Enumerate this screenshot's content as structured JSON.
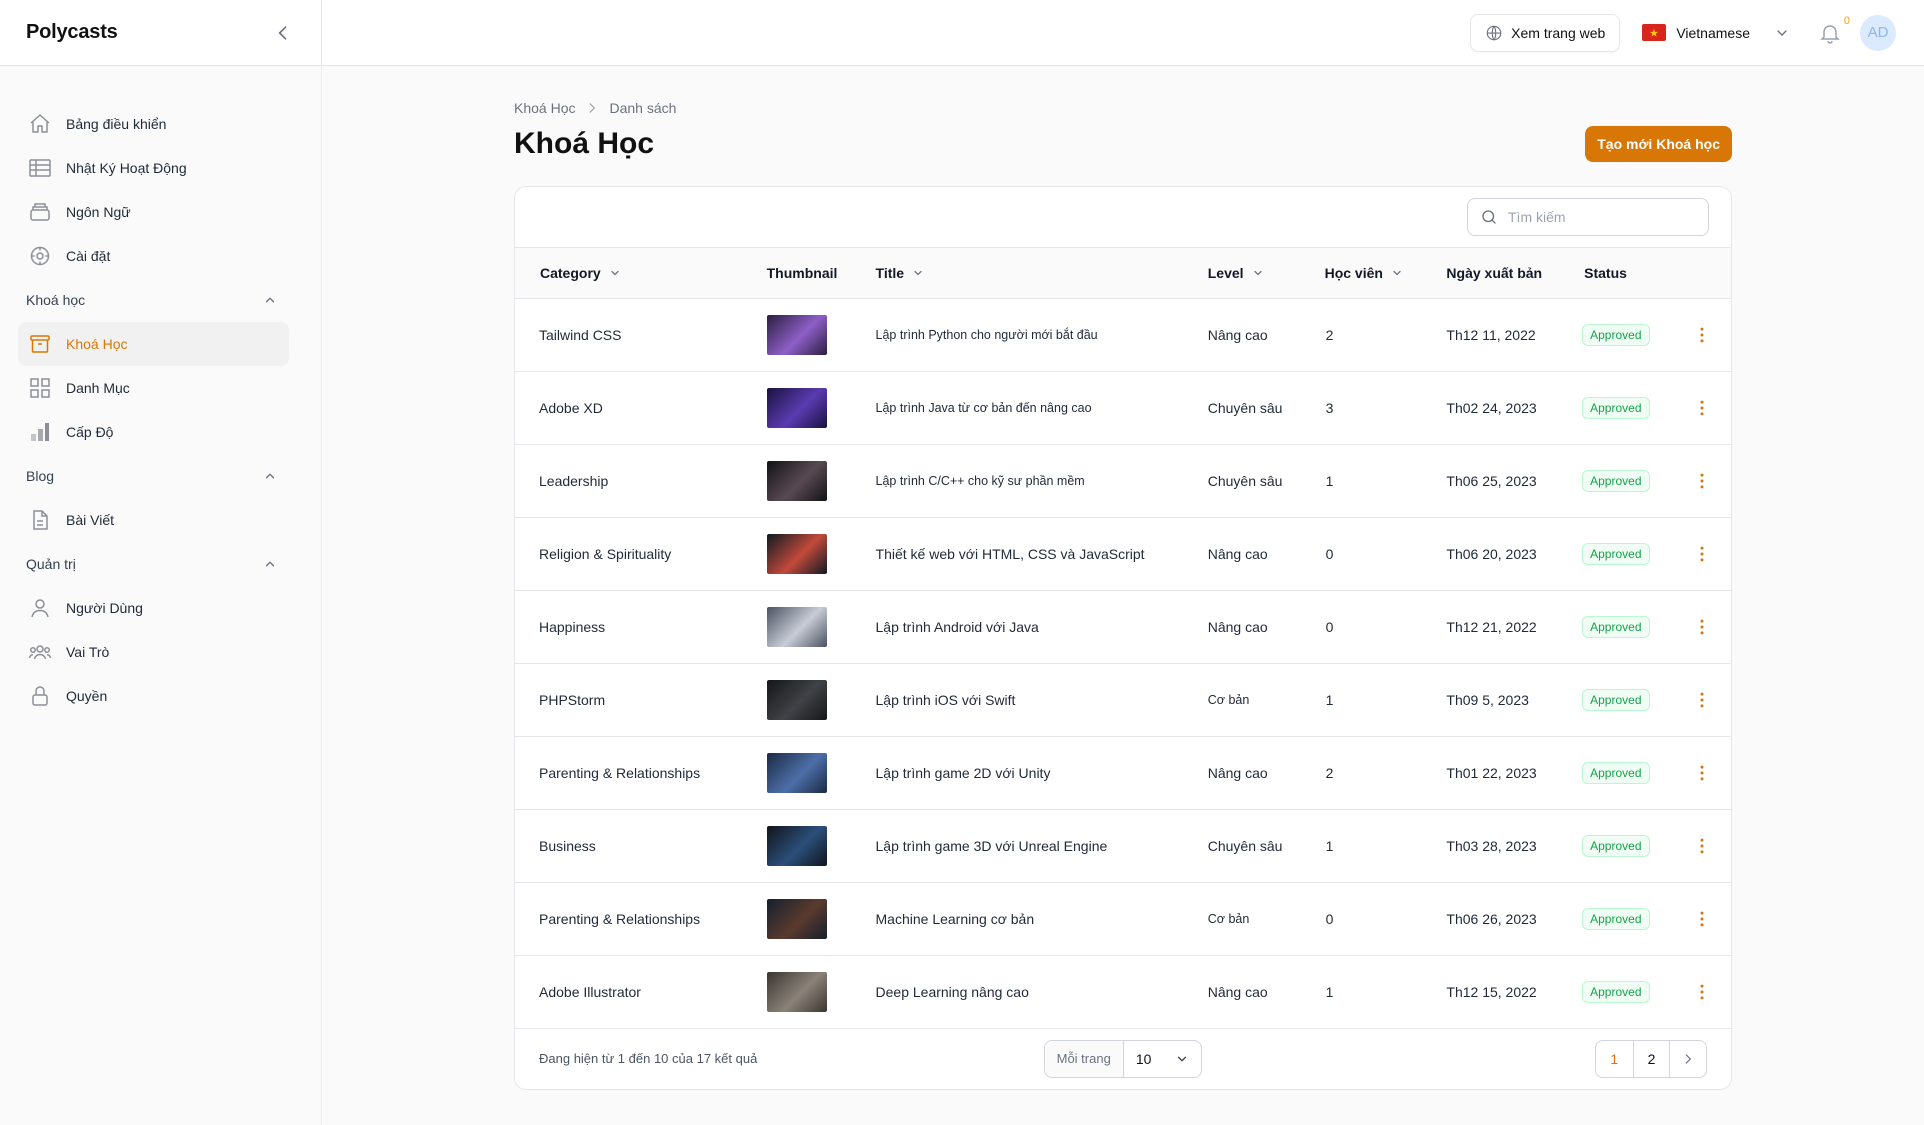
{
  "app": {
    "brand": "Polycasts"
  },
  "topbar": {
    "view_site": "Xem trang web",
    "language": "Vietnamese",
    "notification_count": "0",
    "avatar_initials": "AD"
  },
  "sidebar": {
    "top_items": [
      {
        "label": "Bảng điều khiển",
        "icon": "home-icon"
      },
      {
        "label": "Nhật Ký Hoạt Động",
        "icon": "table-icon"
      },
      {
        "label": "Ngôn Ngữ",
        "icon": "archive-icon"
      },
      {
        "label": "Cài đặt",
        "icon": "gear-icon"
      }
    ],
    "groups": [
      {
        "title": "Khoá học",
        "items": [
          {
            "label": "Khoá Học",
            "icon": "archive-box-icon",
            "active": true
          },
          {
            "label": "Danh Mục",
            "icon": "grid-icon"
          },
          {
            "label": "Cấp Độ",
            "icon": "bar-chart-icon"
          }
        ]
      },
      {
        "title": "Blog",
        "items": [
          {
            "label": "Bài Viết",
            "icon": "document-icon"
          }
        ]
      },
      {
        "title": "Quản trị",
        "items": [
          {
            "label": "Người Dùng",
            "icon": "user-icon"
          },
          {
            "label": "Vai Trò",
            "icon": "users-icon"
          },
          {
            "label": "Quyền",
            "icon": "lock-icon"
          }
        ]
      }
    ]
  },
  "breadcrumb": {
    "parent": "Khoá Học",
    "current": "Danh sách"
  },
  "page": {
    "title": "Khoá Học",
    "create_button": "Tạo mới Khoá học"
  },
  "search": {
    "placeholder": "Tìm kiếm"
  },
  "table": {
    "columns": {
      "category": "Category",
      "thumbnail": "Thumbnail",
      "title": "Title",
      "level": "Level",
      "students": "Học viên",
      "published": "Ngày xuất bản",
      "status": "Status"
    },
    "rows": [
      {
        "category": "Tailwind CSS",
        "title": "Lập trình Python cho người mới bắt đầu",
        "level": "Nâng cao",
        "students": "2",
        "published": "Th12 11, 2022",
        "status": "Approved",
        "thumb": [
          "#2a1e3e",
          "#8e5fc8"
        ]
      },
      {
        "category": "Adobe XD",
        "title": "Lập trình Java từ cơ bản đến nâng cao",
        "level": "Chuyên sâu",
        "students": "3",
        "published": "Th02 24, 2023",
        "status": "Approved",
        "thumb": [
          "#1a1240",
          "#5a3bb0"
        ]
      },
      {
        "category": "Leadership",
        "title": "Lập trình C/C++ cho kỹ sư phần mềm",
        "level": "Chuyên sâu",
        "students": "1",
        "published": "Th06 25, 2023",
        "status": "Approved",
        "thumb": [
          "#111216",
          "#5a4a52"
        ]
      },
      {
        "category": "Religion & Spirituality",
        "title": "Thiết kế web với HTML, CSS và JavaScript",
        "level": "Nâng cao",
        "students": "0",
        "published": "Th06 20, 2023",
        "status": "Approved",
        "thumb": [
          "#0e1a22",
          "#c2493a"
        ]
      },
      {
        "category": "Happiness",
        "title": "Lập trình Android với Java",
        "level": "Nâng cao",
        "students": "0",
        "published": "Th12 21, 2022",
        "status": "Approved",
        "thumb": [
          "#4a5260",
          "#c8ccd6"
        ]
      },
      {
        "category": "PHPStorm",
        "title": "Lập trình iOS với Swift",
        "level": "Cơ bản",
        "students": "1",
        "published": "Th09 5, 2023",
        "status": "Approved",
        "thumb": [
          "#151618",
          "#3f4246"
        ]
      },
      {
        "category": "Parenting & Relationships",
        "title": "Lập trình game 2D với Unity",
        "level": "Nâng cao",
        "students": "2",
        "published": "Th01 22, 2023",
        "status": "Approved",
        "thumb": [
          "#1b2a44",
          "#4c6ea8"
        ]
      },
      {
        "category": "Business",
        "title": "Lập trình game 3D với Unreal Engine",
        "level": "Chuyên sâu",
        "students": "1",
        "published": "Th03 28, 2023",
        "status": "Approved",
        "thumb": [
          "#12141c",
          "#2b4f7a"
        ]
      },
      {
        "category": "Parenting & Relationships",
        "title": "Machine Learning cơ bản",
        "level": "Cơ bản",
        "students": "0",
        "published": "Th06 26, 2023",
        "status": "Approved",
        "thumb": [
          "#14202e",
          "#5b3a2e"
        ]
      },
      {
        "category": "Adobe Illustrator",
        "title": "Deep Learning nâng cao",
        "level": "Nâng cao",
        "students": "1",
        "published": "Th12 15, 2022",
        "status": "Approved",
        "thumb": [
          "#3a3530",
          "#8a8278"
        ]
      }
    ]
  },
  "footer": {
    "summary": "Đang hiện từ 1 đến 10 của 17 kết quả",
    "per_page_label": "Mỗi trang",
    "per_page_value": "10",
    "pages": [
      "1",
      "2"
    ]
  },
  "colors": {
    "accent": "#d97706",
    "success": "#16a34a"
  }
}
